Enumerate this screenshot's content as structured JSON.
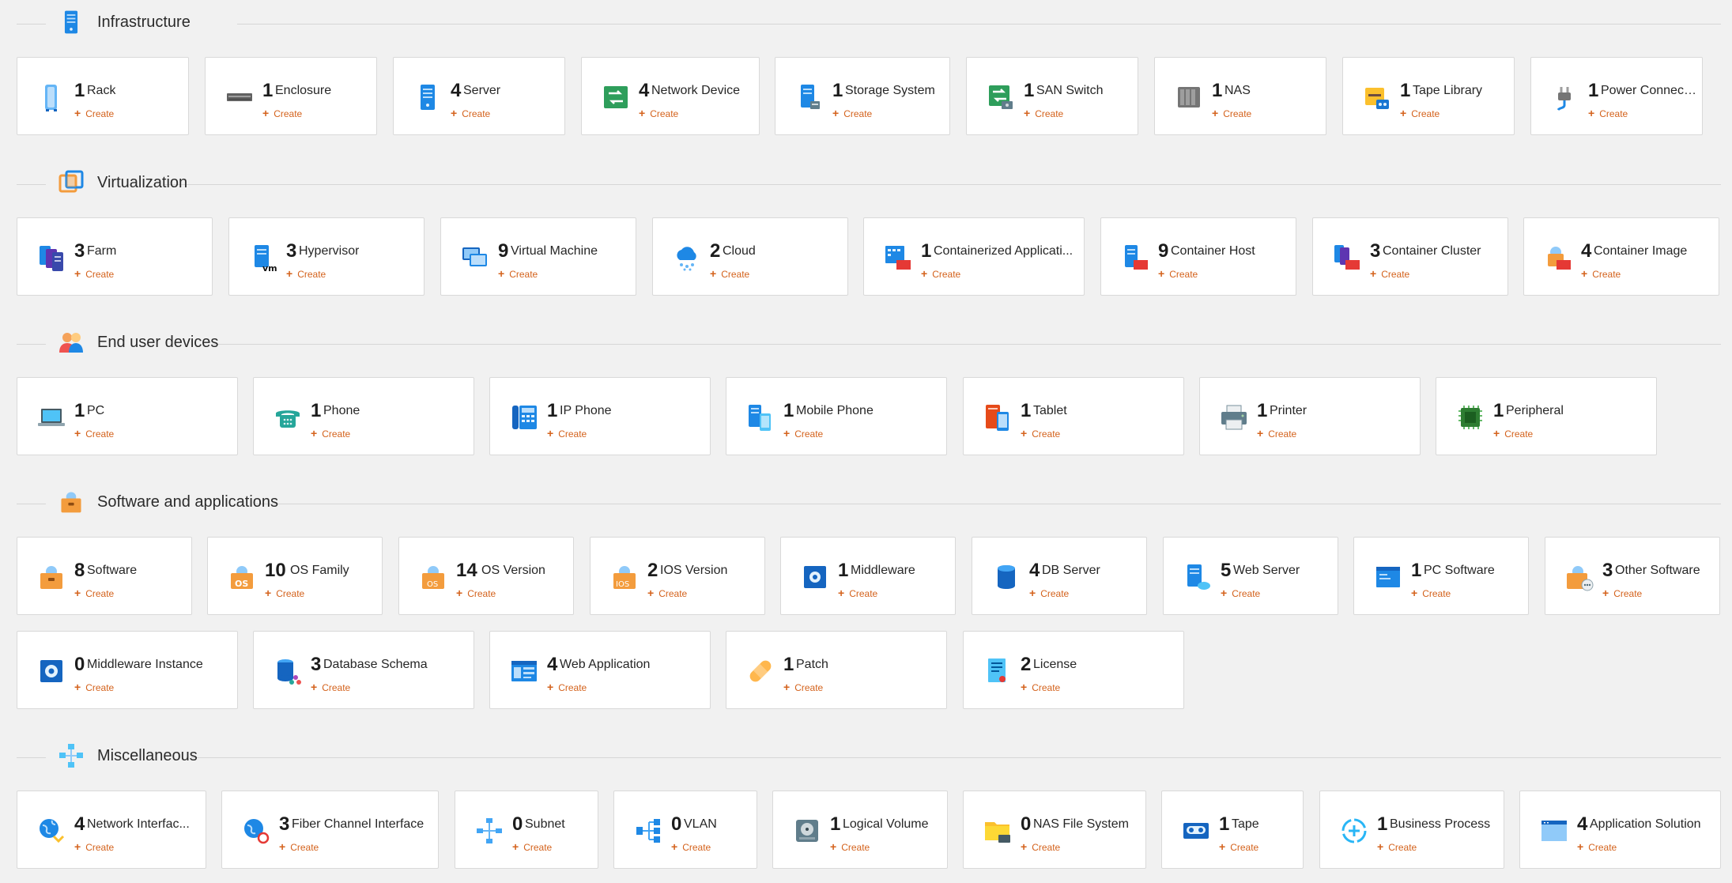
{
  "create_label": "Create",
  "sections": [
    {
      "title": "Infrastructure",
      "icon": "server-icon",
      "cards": [
        {
          "count": "1",
          "label": "Rack",
          "icon": "rack-icon"
        },
        {
          "count": "1",
          "label": "Enclosure",
          "icon": "enclosure-icon"
        },
        {
          "count": "4",
          "label": "Server",
          "icon": "server-icon"
        },
        {
          "count": "4",
          "label": "Network Device",
          "icon": "network-device-icon"
        },
        {
          "count": "1",
          "label": "Storage System",
          "icon": "storage-system-icon"
        },
        {
          "count": "1",
          "label": "SAN Switch",
          "icon": "san-switch-icon"
        },
        {
          "count": "1",
          "label": "NAS",
          "icon": "nas-icon"
        },
        {
          "count": "1",
          "label": "Tape Library",
          "icon": "tape-library-icon"
        },
        {
          "count": "1",
          "label": "Power Connection",
          "icon": "power-plug-icon"
        }
      ]
    },
    {
      "title": "Virtualization",
      "icon": "virtualization-icon",
      "cards": [
        {
          "count": "3",
          "label": "Farm",
          "icon": "farm-icon"
        },
        {
          "count": "3",
          "label": "Hypervisor",
          "icon": "hypervisor-icon"
        },
        {
          "count": "9",
          "label": "Virtual Machine",
          "icon": "virtual-machine-icon"
        },
        {
          "count": "2",
          "label": "Cloud",
          "icon": "cloud-icon"
        },
        {
          "count": "1",
          "label": "Containerized Applicati...",
          "icon": "containerized-app-icon"
        },
        {
          "count": "9",
          "label": "Container Host",
          "icon": "container-host-icon"
        },
        {
          "count": "3",
          "label": "Container Cluster",
          "icon": "container-cluster-icon"
        },
        {
          "count": "4",
          "label": "Container Image",
          "icon": "container-image-icon"
        }
      ]
    },
    {
      "title": "End user devices",
      "icon": "users-icon",
      "cards": [
        {
          "count": "1",
          "label": "PC",
          "icon": "laptop-icon"
        },
        {
          "count": "1",
          "label": "Phone",
          "icon": "phone-icon"
        },
        {
          "count": "1",
          "label": "IP Phone",
          "icon": "ip-phone-icon"
        },
        {
          "count": "1",
          "label": "Mobile Phone",
          "icon": "mobile-phone-icon"
        },
        {
          "count": "1",
          "label": "Tablet",
          "icon": "tablet-icon"
        },
        {
          "count": "1",
          "label": "Printer",
          "icon": "printer-icon"
        },
        {
          "count": "1",
          "label": "Peripheral",
          "icon": "chip-icon"
        }
      ]
    },
    {
      "title": "Software and applications",
      "icon": "software-icon",
      "cards": [
        {
          "count": "8",
          "label": "Software",
          "icon": "software-icon"
        },
        {
          "count": "10",
          "label": "OS Family",
          "icon": "os-family-icon"
        },
        {
          "count": "14",
          "label": "OS Version",
          "icon": "os-version-icon"
        },
        {
          "count": "2",
          "label": "IOS Version",
          "icon": "ios-version-icon"
        },
        {
          "count": "1",
          "label": "Middleware",
          "icon": "middleware-icon"
        },
        {
          "count": "4",
          "label": "DB Server",
          "icon": "database-icon"
        },
        {
          "count": "5",
          "label": "Web Server",
          "icon": "web-server-icon"
        },
        {
          "count": "1",
          "label": "PC Software",
          "icon": "pc-software-icon"
        },
        {
          "count": "3",
          "label": "Other Software",
          "icon": "other-software-icon"
        },
        {
          "count": "0",
          "label": "Middleware Instance",
          "icon": "middleware-instance-icon"
        },
        {
          "count": "3",
          "label": "Database Schema",
          "icon": "database-schema-icon"
        },
        {
          "count": "4",
          "label": "Web Application",
          "icon": "web-application-icon"
        },
        {
          "count": "1",
          "label": "Patch",
          "icon": "patch-icon"
        },
        {
          "count": "2",
          "label": "License",
          "icon": "license-icon"
        }
      ]
    },
    {
      "title": "Miscellaneous",
      "icon": "network-nodes-icon",
      "cards": [
        {
          "count": "4",
          "label": "Network Interfac...",
          "icon": "network-interface-icon"
        },
        {
          "count": "3",
          "label": "Fiber Channel Interface",
          "icon": "fiber-channel-icon"
        },
        {
          "count": "0",
          "label": "Subnet",
          "icon": "subnet-icon"
        },
        {
          "count": "0",
          "label": "VLAN",
          "icon": "vlan-icon"
        },
        {
          "count": "1",
          "label": "Logical Volume",
          "icon": "logical-volume-icon"
        },
        {
          "count": "0",
          "label": "NAS File System",
          "icon": "nas-file-system-icon"
        },
        {
          "count": "1",
          "label": "Tape",
          "icon": "tape-icon"
        },
        {
          "count": "1",
          "label": "Business Process",
          "icon": "business-process-icon"
        },
        {
          "count": "4",
          "label": "Application Solution",
          "icon": "application-solution-icon"
        }
      ]
    }
  ]
}
